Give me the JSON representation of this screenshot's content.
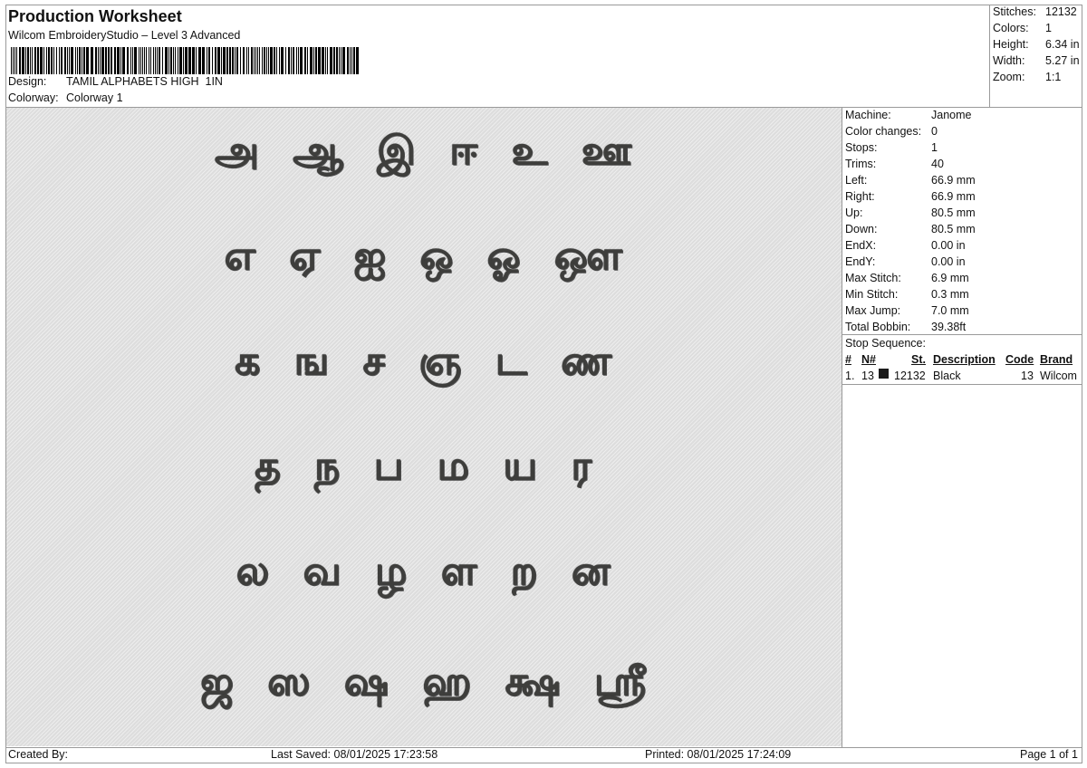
{
  "header": {
    "title": "Production Worksheet",
    "subtitle": "Wilcom EmbroideryStudio – Level 3 Advanced",
    "design_label": "Design:",
    "design_value": "TAMIL ALPHABETS HIGH  1IN",
    "colorway_label": "Colorway:",
    "colorway_value": "Colorway 1"
  },
  "stats": [
    {
      "label": "Stitches:",
      "value": "12132"
    },
    {
      "label": "Colors:",
      "value": "1"
    },
    {
      "label": "Height:",
      "value": "6.34 in"
    },
    {
      "label": "Width:",
      "value": "5.27 in"
    },
    {
      "label": "Zoom:",
      "value": "1:1"
    }
  ],
  "design_rows": [
    "அ ஆ இ ஈ உ ஊ",
    "எ ஏ ஐ ஒ ஓ ஔ",
    "க ங ச ஞ ட ண",
    "த ந ப ம ய ர",
    "ல வ ழ ள ற ன",
    "ஜ ஸ ஷ ஹ க்ஷ ஸ்ரீ"
  ],
  "machine_info": [
    {
      "label": "Machine:",
      "value": "Janome"
    },
    {
      "label": "Color changes:",
      "value": "0"
    },
    {
      "label": "Stops:",
      "value": "1"
    },
    {
      "label": "Trims:",
      "value": "40"
    },
    {
      "label": "Left:",
      "value": "66.9 mm"
    },
    {
      "label": "Right:",
      "value": "66.9 mm"
    },
    {
      "label": "Up:",
      "value": "80.5 mm"
    },
    {
      "label": "Down:",
      "value": "80.5 mm"
    },
    {
      "label": "EndX:",
      "value": "0.00 in"
    },
    {
      "label": "EndY:",
      "value": "0.00 in"
    },
    {
      "label": "Max Stitch:",
      "value": "6.9 mm"
    },
    {
      "label": "Min Stitch:",
      "value": "0.3 mm"
    },
    {
      "label": "Max Jump:",
      "value": "7.0 mm"
    },
    {
      "label": "Total Bobbin:",
      "value": "39.38ft"
    }
  ],
  "stop_sequence": {
    "heading": "Stop Sequence:",
    "columns": [
      "#",
      "N#",
      "St.",
      "Description",
      "Code",
      "Brand"
    ],
    "rows": [
      {
        "index": "1.",
        "needle": "13",
        "color": "#1a1a1a",
        "stitches": "12132",
        "description": "Black",
        "code": "13",
        "brand": "Wilcom"
      }
    ]
  },
  "footer": {
    "created_by": "Created By:",
    "last_saved": "Last Saved: 08/01/2025 17:23:58",
    "printed": "Printed: 08/01/2025 17:24:09",
    "page": "Page 1 of 1"
  }
}
